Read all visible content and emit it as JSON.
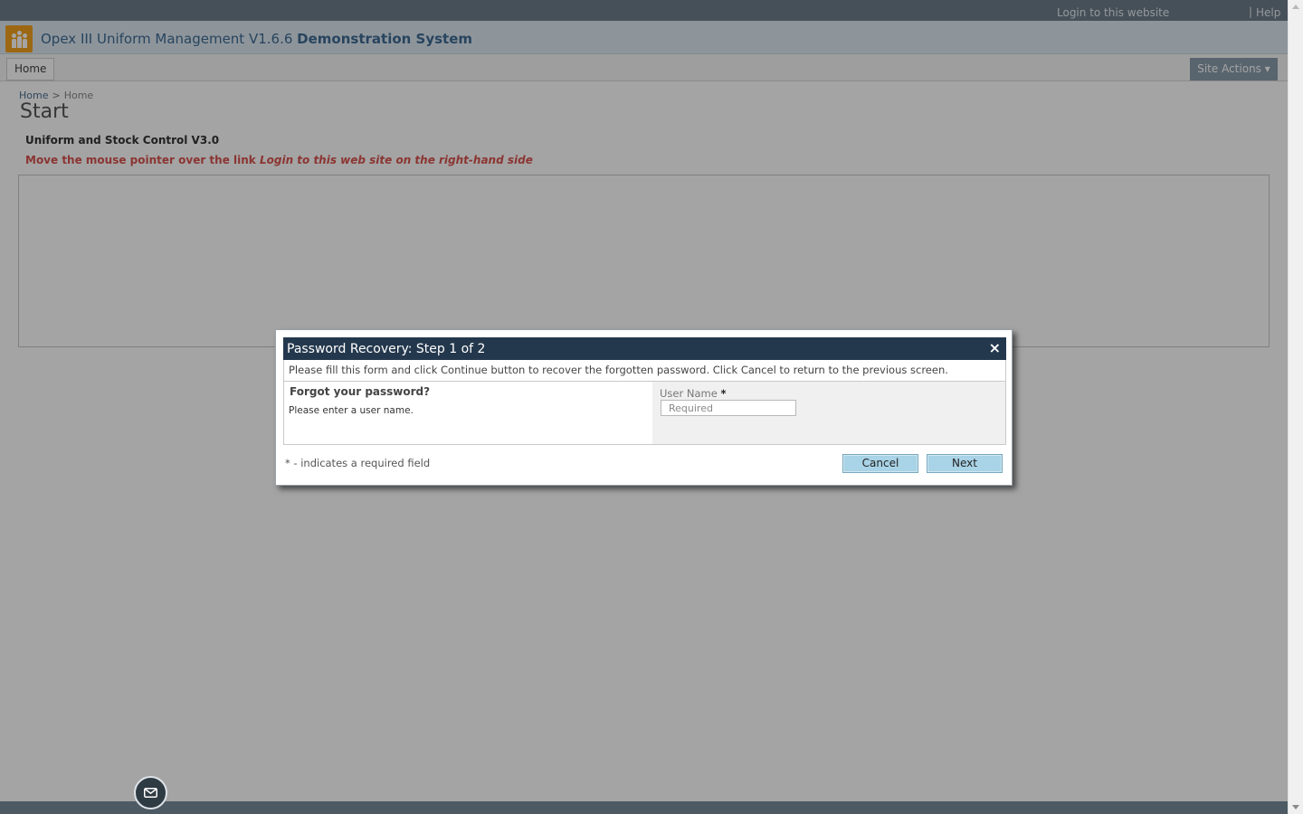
{
  "topbar": {
    "login_link": "Login to this website",
    "separator": "|",
    "help_link": "Help"
  },
  "site": {
    "title_normal": "Opex III Uniform Management V1.6.6",
    "title_bold": "Demonstration System",
    "logo_icon": "people-logo-icon"
  },
  "nav": {
    "home_tab": "Home",
    "site_actions": "Site Actions ▾"
  },
  "breadcrumb": {
    "root": "Home",
    "separator": ">",
    "current": "Home"
  },
  "main": {
    "page_title": "Start",
    "subtitle": "Uniform and Stock Control V3.0",
    "instruction_prefix": "Move the mouse pointer over the link",
    "instruction_italic": "Login to this web site on the right-hand side"
  },
  "dialog": {
    "title": "Password Recovery: Step 1 of 2",
    "close_symbol": "×",
    "description": "Please fill this form and click Continue button to recover the forgotten password. Click Cancel to return to the previous screen.",
    "section_title": "Forgot your password?",
    "section_desc": "Please enter a user name.",
    "field_label": "User Name",
    "required_marker": "*",
    "field_placeholder": "Required",
    "field_value": "",
    "footnote": "* - indicates a required field",
    "cancel_label": "Cancel",
    "next_label": "Next"
  },
  "colors": {
    "header_bar": "#24384d",
    "button_bg": "#a9d3e6",
    "instruction_red": "#d9534f",
    "title_blue": "#3f6a92"
  },
  "floating": {
    "mail_icon": "envelope-icon"
  }
}
